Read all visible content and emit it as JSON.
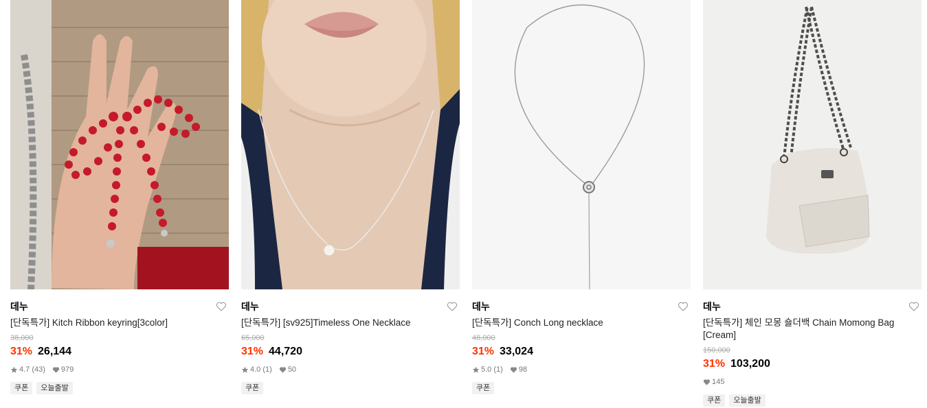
{
  "products": [
    {
      "brand": "데누",
      "name": "[단독특가] Kitch Ribbon keyring[3color]",
      "original_price": "38,000",
      "discount": "31%",
      "price": "26,144",
      "rating": "4.7",
      "reviews": "(43)",
      "likes": "979",
      "tags": [
        "쿠폰",
        "오늘출발"
      ],
      "image_icon": "red-bead-ribbon-keyring-photo"
    },
    {
      "brand": "데누",
      "name": "[단독특가] [sv925]Timeless One Necklace",
      "original_price": "65,000",
      "discount": "31%",
      "price": "44,720",
      "rating": "4.0",
      "reviews": "(1)",
      "likes": "50",
      "tags": [
        "쿠폰"
      ],
      "image_icon": "pearl-necklace-model-photo"
    },
    {
      "brand": "데누",
      "name": "[단독특가] Conch Long necklace",
      "original_price": "48,000",
      "discount": "31%",
      "price": "33,024",
      "rating": "5.0",
      "reviews": "(1)",
      "likes": "98",
      "tags": [
        "쿠폰"
      ],
      "image_icon": "silver-long-necklace-photo"
    },
    {
      "brand": "데누",
      "name": "[단독특가] 체인 모몽 숄더백 Chain Momong Bag [Cream]",
      "original_price": "150,000",
      "discount": "31%",
      "price": "103,200",
      "rating": "",
      "reviews": "",
      "likes": "145",
      "tags": [
        "쿠폰",
        "오늘출발"
      ],
      "image_icon": "cream-chain-shoulder-bag-photo"
    }
  ],
  "colors": {
    "discount": "#ff3300",
    "tag_bg": "#f1f1f1",
    "muted": "#777777"
  }
}
